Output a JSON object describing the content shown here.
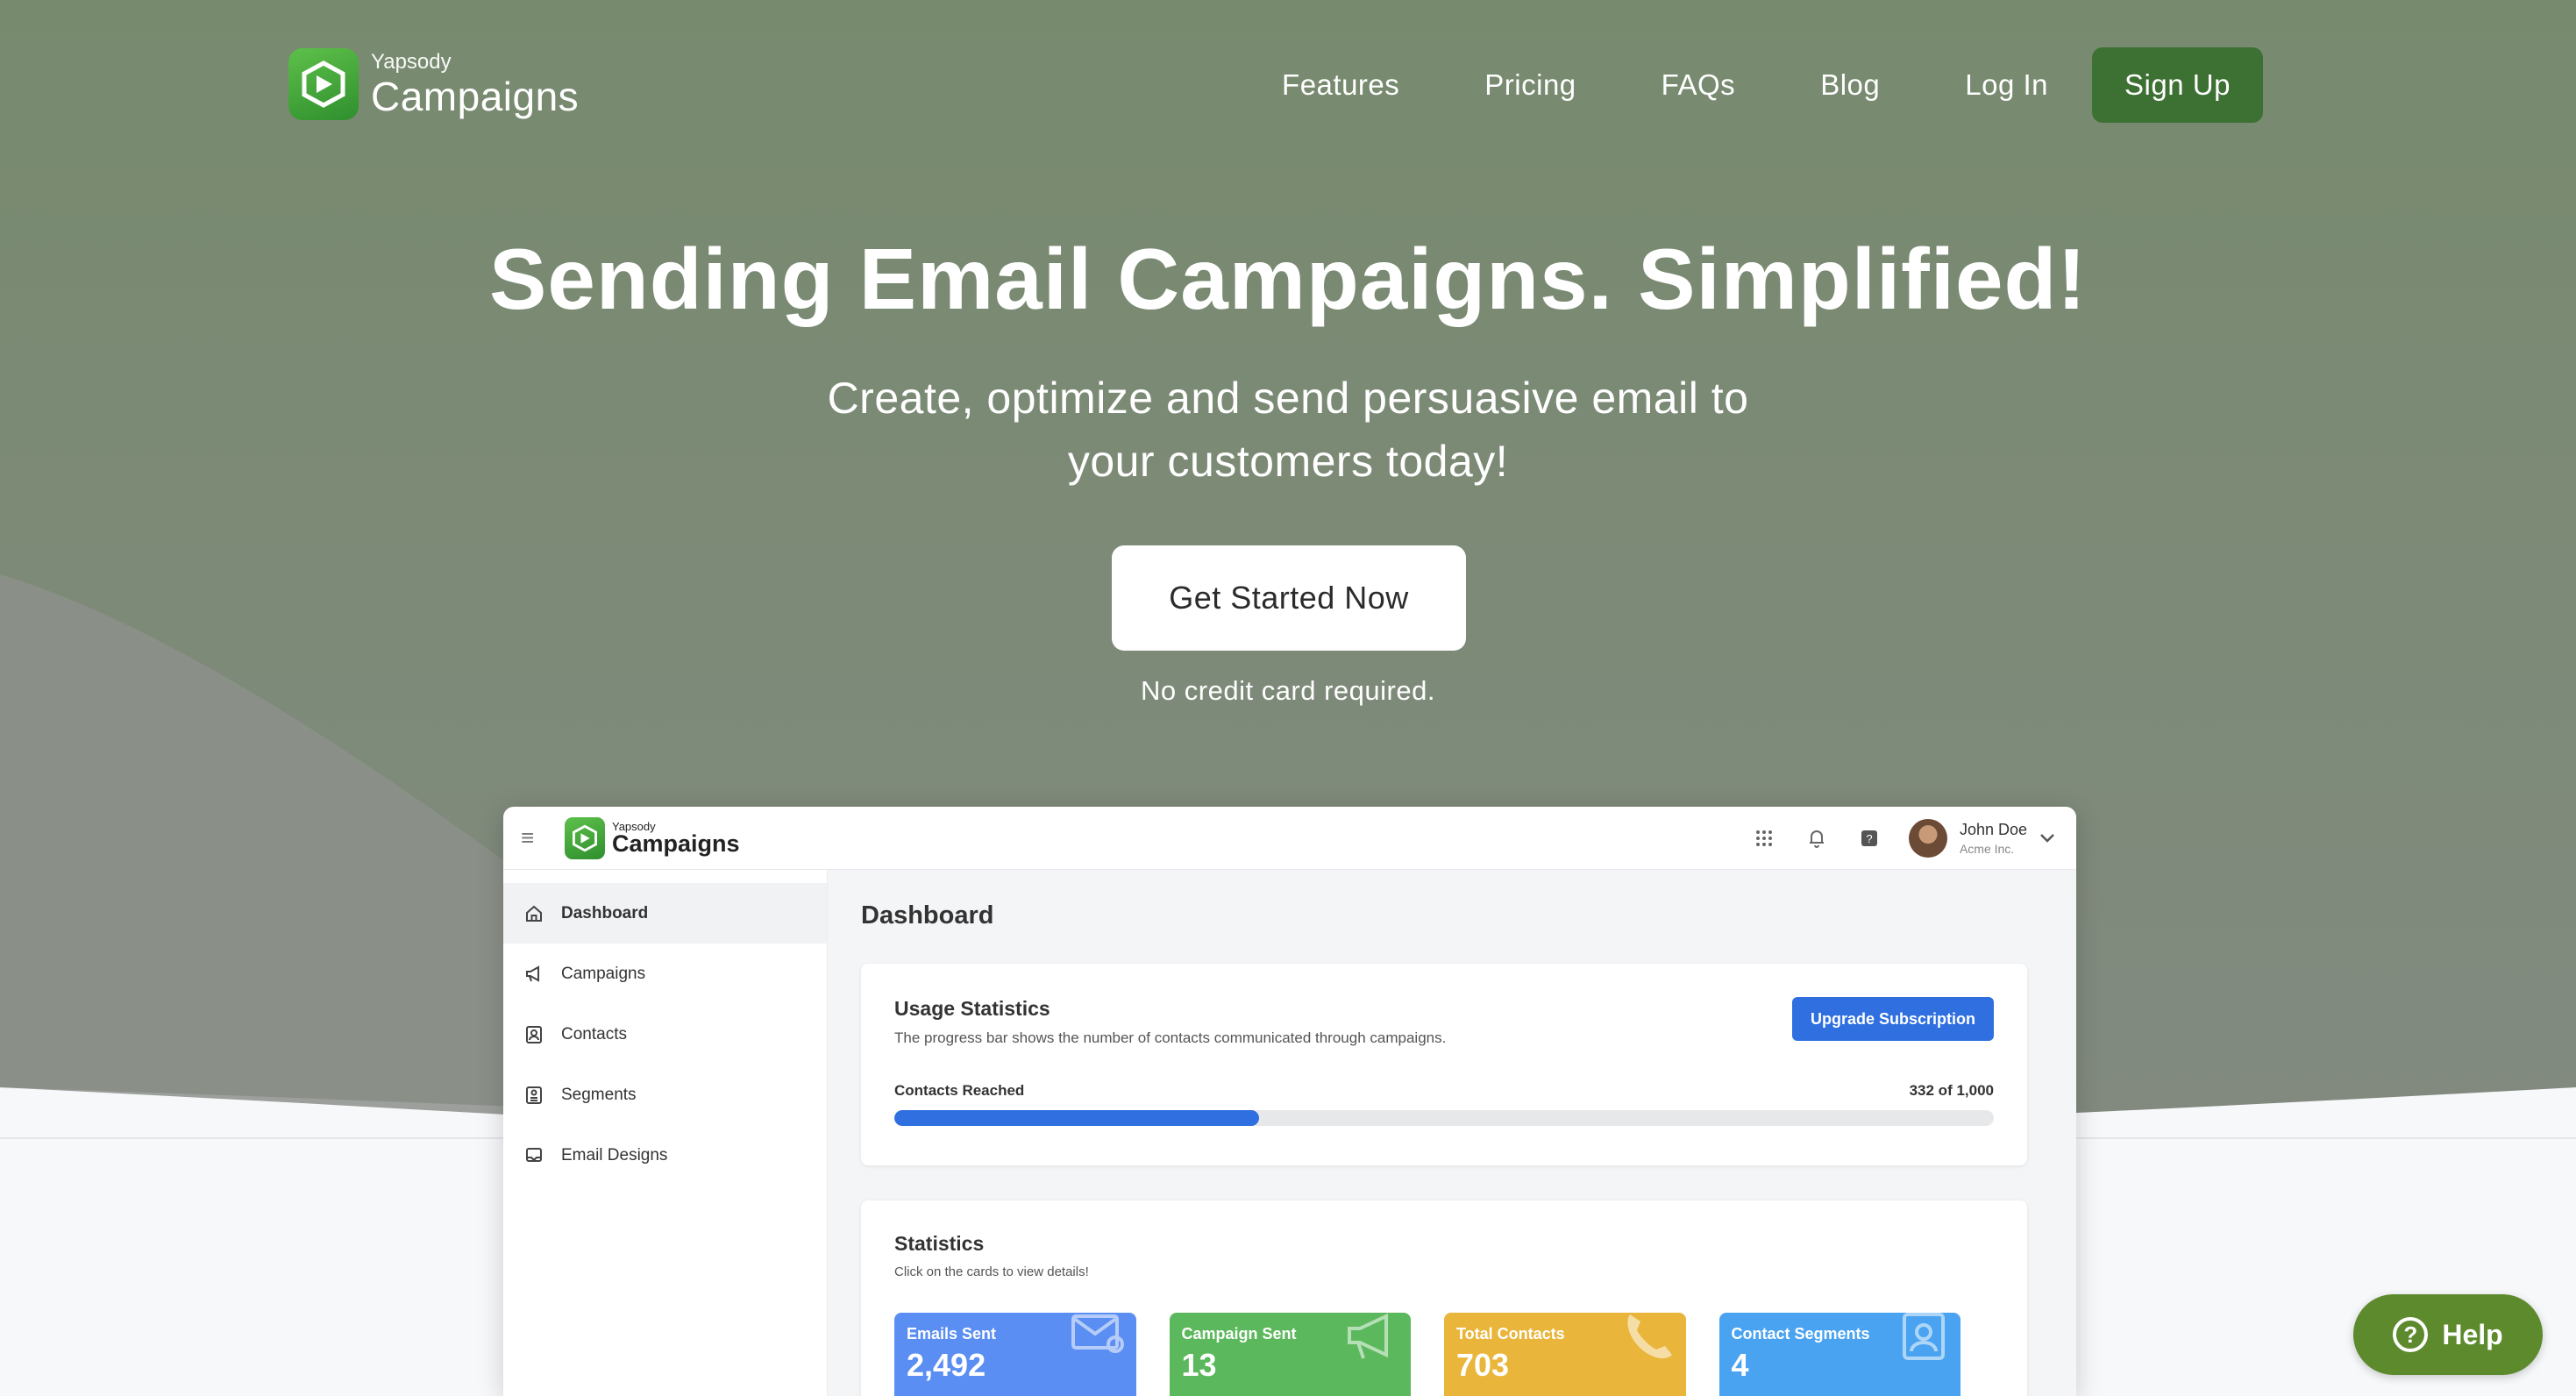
{
  "brand": {
    "small": "Yapsody",
    "big": "Campaigns"
  },
  "nav": {
    "links": [
      "Features",
      "Pricing",
      "FAQs",
      "Blog",
      "Log In"
    ],
    "signup": "Sign Up"
  },
  "hero": {
    "headline": "Sending Email Campaigns. Simplified!",
    "subline_1": "Create, optimize and send persuasive email to",
    "subline_2": "your customers today!",
    "cta": "Get Started Now",
    "note": "No credit card required."
  },
  "app": {
    "brand": {
      "small": "Yapsody",
      "big": "Campaigns"
    },
    "user": {
      "name": "John Doe",
      "company": "Acme Inc."
    },
    "sidebar": [
      {
        "label": "Dashboard",
        "icon": "home-icon",
        "active": true
      },
      {
        "label": "Campaigns",
        "icon": "megaphone-icon"
      },
      {
        "label": "Contacts",
        "icon": "contact-card-icon"
      },
      {
        "label": "Segments",
        "icon": "segments-icon"
      },
      {
        "label": "Email Designs",
        "icon": "email-design-icon"
      }
    ],
    "title": "Dashboard",
    "usage": {
      "title": "Usage Statistics",
      "subtitle": "The progress bar shows the number of contacts communicated through campaigns.",
      "upgrade": "Upgrade Subscription",
      "reached_label": "Contacts Reached",
      "reached_text": "332 of 1,000",
      "reached": 332,
      "total": 1000
    },
    "stats": {
      "title": "Statistics",
      "subtitle": "Click on the cards to view details!",
      "tiles": [
        {
          "label": "Emails Sent",
          "value": "2,492",
          "color": "#5b8ef2",
          "icon": "envelope-icon"
        },
        {
          "label": "Campaign Sent",
          "value": "13",
          "color": "#5cb85c",
          "icon": "megaphone-icon"
        },
        {
          "label": "Total Contacts",
          "value": "703",
          "color": "#e9b53a",
          "icon": "phone-icon"
        },
        {
          "label": "Contact Segments",
          "value": "4",
          "color": "#4aa3f0",
          "icon": "contact-card-icon"
        }
      ]
    }
  },
  "help": "Help",
  "colors": {
    "hero_bg": "#7b8875",
    "signup_bg": "#3d7033",
    "accent_blue": "#2f6fe0",
    "help_bg": "#5c8a2c"
  }
}
